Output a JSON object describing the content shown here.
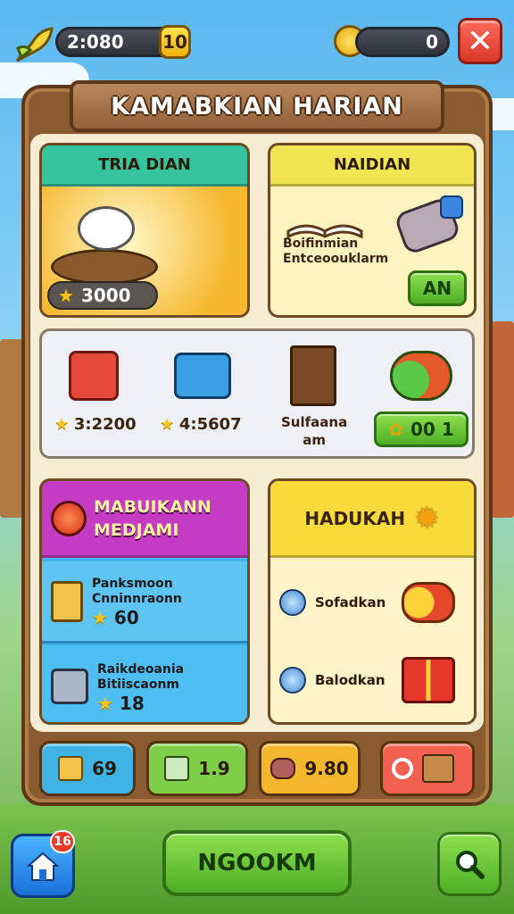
{
  "top": {
    "left_value": "2:080",
    "left_badge": "10",
    "right_value": "0"
  },
  "title": "KAMABKIAN HARIAN",
  "panels": {
    "left_top": {
      "title": "TRIA DIAN",
      "price": "3000"
    },
    "right_top": {
      "title": "NAIDIAN",
      "desc_line1": "Boifinmian",
      "desc_line2": "Entceoouklarm",
      "button": "AN"
    },
    "middle_row": {
      "items": [
        {
          "icon": "red-basket-icon",
          "price": "3:2200"
        },
        {
          "icon": "blue-crate-icon",
          "price": "4:5607"
        },
        {
          "icon": "wooden-door-icon",
          "label_line1": "Sulfaana",
          "label_line2": "am"
        },
        {
          "icon": "fruit-pile-icon",
          "badge": "00 1"
        }
      ]
    },
    "left_bottom": {
      "title_line1": "MABUIKANN",
      "title_line2": "MEDJAMI",
      "rows": [
        {
          "icon": "scroll-icon",
          "line1": "Panksmoon",
          "line2": "Cnninnraonn",
          "value": "60"
        },
        {
          "icon": "toolbox-icon",
          "line1": "Raikdeoania",
          "line2": "Bitiiscaonm",
          "value": "18"
        }
      ]
    },
    "right_bottom": {
      "title": "HADUKAH",
      "rows": [
        {
          "icon": "orb-icon",
          "label": "Sofadkan"
        },
        {
          "icon": "orb-icon",
          "label": "Balodkan"
        }
      ]
    }
  },
  "bottom_cards": [
    {
      "value": "69",
      "color": "#3fb2e6"
    },
    {
      "value": "1.9",
      "color": "#7fce48"
    },
    {
      "value": "9.80",
      "color": "#f4b62c"
    },
    {
      "value": "",
      "color": "#f26050"
    }
  ],
  "nav": {
    "home_badge": "16",
    "main_button": "NGOOKM"
  },
  "colors": {
    "teal_header": "#35c3a0",
    "yellow_header": "#f0e550",
    "magenta_header": "#c63bc4",
    "blue_panel": "#45b3ec"
  }
}
